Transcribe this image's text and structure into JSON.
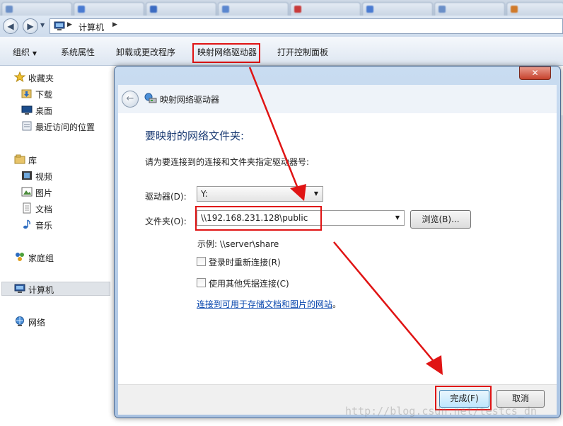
{
  "breadcrumb": {
    "location": "计算机"
  },
  "toolbar": {
    "organize": "组织",
    "system_properties": "系统属性",
    "uninstall": "卸载或更改程序",
    "map_drive": "映射网络驱动器",
    "control_panel": "打开控制面板"
  },
  "nav": {
    "favorites": "收藏夹",
    "downloads": "下载",
    "desktop": "桌面",
    "recent": "最近访问的位置",
    "libraries": "库",
    "videos": "视频",
    "pictures": "图片",
    "documents": "文档",
    "music": "音乐",
    "homegroup": "家庭组",
    "computer": "计算机",
    "network": "网络"
  },
  "dialog": {
    "title": "映射网络驱动器",
    "heading": "要映射的网络文件夹:",
    "instruction": "请为要连接到的连接和文件夹指定驱动器号:",
    "drive_label": "驱动器(D):",
    "drive_value": "Y:",
    "folder_label": "文件夹(O):",
    "folder_value": "\\\\192.168.231.128\\public",
    "browse": "浏览(B)...",
    "example": "示例: \\\\server\\share",
    "reconnect": "登录时重新连接(R)",
    "reconnect_checked": false,
    "other_credentials": "使用其他凭据连接(C)",
    "other_credentials_checked": false,
    "link": "连接到可用于存储文档和图片的网站",
    "link_suffix": "。",
    "finish": "完成(F)",
    "cancel": "取消"
  },
  "watermark": "http://blog.csdn.net/testcs_dn",
  "colors": {
    "highlight": "#e01414",
    "link": "#0645ad",
    "heading": "#1b3b73"
  }
}
